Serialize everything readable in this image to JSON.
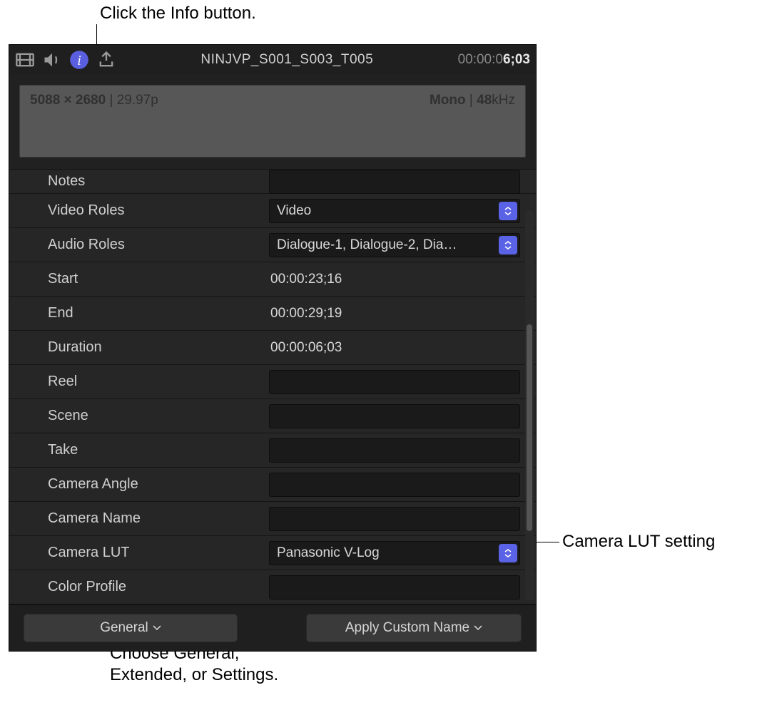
{
  "callouts": {
    "top": "Click the Info button.",
    "right": "Camera LUT setting",
    "bottom": "Choose General,\nExtended, or Settings."
  },
  "header": {
    "clip_title": "NINJVP_S001_S003_T005",
    "timecode_gray": "00:00:0",
    "timecode_white": "6;03"
  },
  "summary": {
    "resolution": "5088 × 2680",
    "fps": "29.97p",
    "audio_channels": "Mono",
    "audio_rate_bold": "48",
    "audio_rate_unit": "kHz"
  },
  "rows": {
    "notes": {
      "label": "Notes",
      "value": ""
    },
    "video_roles": {
      "label": "Video Roles",
      "value": "Video"
    },
    "audio_roles": {
      "label": "Audio Roles",
      "value": "Dialogue-1, Dialogue-2, Dia…"
    },
    "start": {
      "label": "Start",
      "value": "00:00:23;16"
    },
    "end": {
      "label": "End",
      "value": "00:00:29;19"
    },
    "duration": {
      "label": "Duration",
      "value": "00:00:06;03"
    },
    "reel": {
      "label": "Reel",
      "value": ""
    },
    "scene": {
      "label": "Scene",
      "value": ""
    },
    "take": {
      "label": "Take",
      "value": ""
    },
    "camera_angle": {
      "label": "Camera Angle",
      "value": ""
    },
    "camera_name": {
      "label": "Camera Name",
      "value": ""
    },
    "camera_lut": {
      "label": "Camera LUT",
      "value": "Panasonic V-Log"
    },
    "color_profile": {
      "label": "Color Profile",
      "value": ""
    }
  },
  "footer": {
    "view_menu": "General",
    "apply_name": "Apply Custom Name"
  }
}
